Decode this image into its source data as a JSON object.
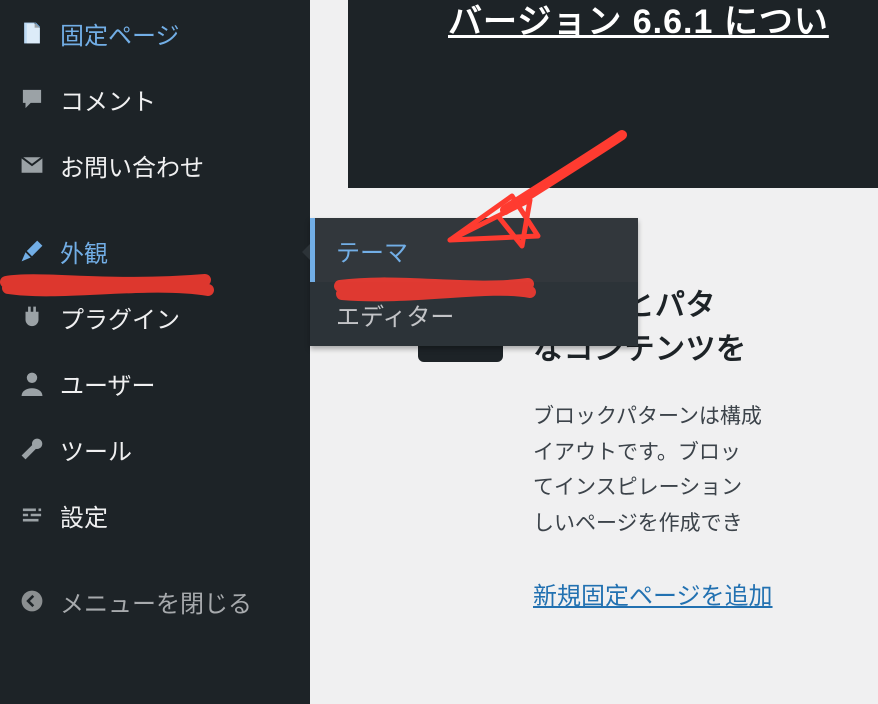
{
  "sidebar": {
    "items": [
      {
        "label": "固定ページ"
      },
      {
        "label": "コメント"
      },
      {
        "label": "お問い合わせ"
      },
      {
        "label": "外観"
      },
      {
        "label": "プラグイン"
      },
      {
        "label": "ユーザー"
      },
      {
        "label": "ツール"
      },
      {
        "label": "設定"
      }
    ],
    "collapse_label": "メニューを閉じる"
  },
  "submenu": {
    "items": [
      {
        "label": "テーマ"
      },
      {
        "label": "エディター"
      }
    ]
  },
  "hero": {
    "title": "バージョン 6.6.1 につい"
  },
  "feature": {
    "heading_line1": "ロックとパタ",
    "heading_line2": "なコンテンツを",
    "paragraph_line1": "ブロックパターンは構成",
    "paragraph_line2": "イアウトです。ブロッ",
    "paragraph_line3": "てインスピレーション",
    "paragraph_line4": "しいページを作成でき",
    "link_label": "新規固定ページを追加"
  }
}
